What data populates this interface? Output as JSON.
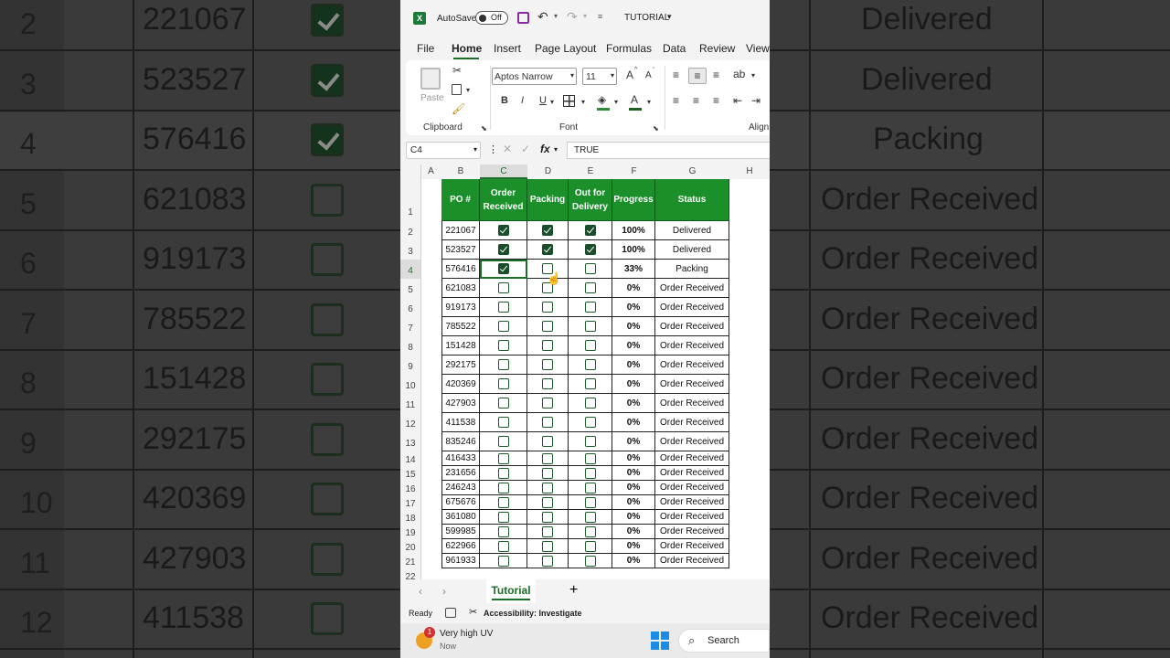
{
  "app": {
    "autosave_label": "AutoSave",
    "autosave_state": "Off",
    "file_name": "TUTORIAL"
  },
  "menu": [
    "File",
    "Home",
    "Insert",
    "Page Layout",
    "Formulas",
    "Data",
    "Review",
    "View"
  ],
  "ribbon": {
    "paste_label": "Paste",
    "clipboard_label": "Clipboard",
    "font_name": "Aptos Narrow",
    "font_size": "11",
    "font_group_label": "Font",
    "align_group_label": "Alignm",
    "bold": "B",
    "italic": "I",
    "underline": "U",
    "grow": "A",
    "shrink": "A"
  },
  "formula_bar": {
    "cell_ref": "C4",
    "fx": "fx",
    "value": "TRUE"
  },
  "columns": [
    "A",
    "B",
    "C",
    "D",
    "E",
    "F",
    "G",
    "H"
  ],
  "headers": {
    "po": "PO #",
    "order_received": "Order Received",
    "packing": "Packing",
    "out_for_delivery": "Out for Delivery",
    "progress": "Progress",
    "status": "Status"
  },
  "rows": [
    {
      "n": "2",
      "po": "221067",
      "c": true,
      "d": true,
      "e": true,
      "progress": "100%",
      "status": "Delivered"
    },
    {
      "n": "3",
      "po": "523527",
      "c": true,
      "d": true,
      "e": true,
      "progress": "100%",
      "status": "Delivered"
    },
    {
      "n": "4",
      "po": "576416",
      "c": true,
      "d": false,
      "e": false,
      "progress": "33%",
      "status": "Packing"
    },
    {
      "n": "5",
      "po": "621083",
      "c": false,
      "d": false,
      "e": false,
      "progress": "0%",
      "status": "Order Received"
    },
    {
      "n": "6",
      "po": "919173",
      "c": false,
      "d": false,
      "e": false,
      "progress": "0%",
      "status": "Order Received"
    },
    {
      "n": "7",
      "po": "785522",
      "c": false,
      "d": false,
      "e": false,
      "progress": "0%",
      "status": "Order Received"
    },
    {
      "n": "8",
      "po": "151428",
      "c": false,
      "d": false,
      "e": false,
      "progress": "0%",
      "status": "Order Received"
    },
    {
      "n": "9",
      "po": "292175",
      "c": false,
      "d": false,
      "e": false,
      "progress": "0%",
      "status": "Order Received"
    },
    {
      "n": "10",
      "po": "420369",
      "c": false,
      "d": false,
      "e": false,
      "progress": "0%",
      "status": "Order Received"
    },
    {
      "n": "11",
      "po": "427903",
      "c": false,
      "d": false,
      "e": false,
      "progress": "0%",
      "status": "Order Received"
    },
    {
      "n": "12",
      "po": "411538",
      "c": false,
      "d": false,
      "e": false,
      "progress": "0%",
      "status": "Order Received"
    },
    {
      "n": "13",
      "po": "835246",
      "c": false,
      "d": false,
      "e": false,
      "progress": "0%",
      "status": "Order Received"
    },
    {
      "n": "14",
      "po": "416433",
      "c": false,
      "d": false,
      "e": false,
      "progress": "0%",
      "status": "Order Received"
    },
    {
      "n": "15",
      "po": "231656",
      "c": false,
      "d": false,
      "e": false,
      "progress": "0%",
      "status": "Order Received"
    },
    {
      "n": "16",
      "po": "246243",
      "c": false,
      "d": false,
      "e": false,
      "progress": "0%",
      "status": "Order Received"
    },
    {
      "n": "17",
      "po": "675676",
      "c": false,
      "d": false,
      "e": false,
      "progress": "0%",
      "status": "Order Received"
    },
    {
      "n": "18",
      "po": "361080",
      "c": false,
      "d": false,
      "e": false,
      "progress": "0%",
      "status": "Order Received"
    },
    {
      "n": "19",
      "po": "599985",
      "c": false,
      "d": false,
      "e": false,
      "progress": "0%",
      "status": "Order Received"
    },
    {
      "n": "20",
      "po": "622966",
      "c": false,
      "d": false,
      "e": false,
      "progress": "0%",
      "status": "Order Received"
    },
    {
      "n": "21",
      "po": "961933",
      "c": false,
      "d": false,
      "e": false,
      "progress": "0%",
      "status": "Order Received"
    }
  ],
  "row1_label": "1",
  "row22_label": "22",
  "sheet": {
    "tab": "Tutorial",
    "add": "+"
  },
  "status": {
    "ready": "Ready",
    "accessibility": "Accessibility: Investigate"
  },
  "taskbar": {
    "weather_title": "Very high UV",
    "weather_sub": "Now",
    "badge": "1",
    "search": "Search"
  },
  "background": {
    "rows": [
      {
        "n": "2",
        "po": "221067",
        "on": true,
        "status": "Delivered"
      },
      {
        "n": "3",
        "po": "523527",
        "on": true,
        "status": "Delivered"
      },
      {
        "n": "4",
        "po": "576416",
        "on": true,
        "status": "Packing"
      },
      {
        "n": "5",
        "po": "621083",
        "on": false,
        "status": "Order Received"
      },
      {
        "n": "6",
        "po": "919173",
        "on": false,
        "status": "Order Received"
      },
      {
        "n": "7",
        "po": "785522",
        "on": false,
        "status": "Order Received"
      },
      {
        "n": "8",
        "po": "151428",
        "on": false,
        "status": "Order Received"
      },
      {
        "n": "9",
        "po": "292175",
        "on": false,
        "status": "Order Received"
      },
      {
        "n": "10",
        "po": "420369",
        "on": false,
        "status": "Order Received"
      },
      {
        "n": "11",
        "po": "427903",
        "on": false,
        "status": "Order Received"
      },
      {
        "n": "12",
        "po": "411538",
        "on": false,
        "status": "Order Received"
      }
    ]
  },
  "colors": {
    "header_green": "#1b8f2a",
    "checkbox_dark": "#1a4d2a"
  }
}
